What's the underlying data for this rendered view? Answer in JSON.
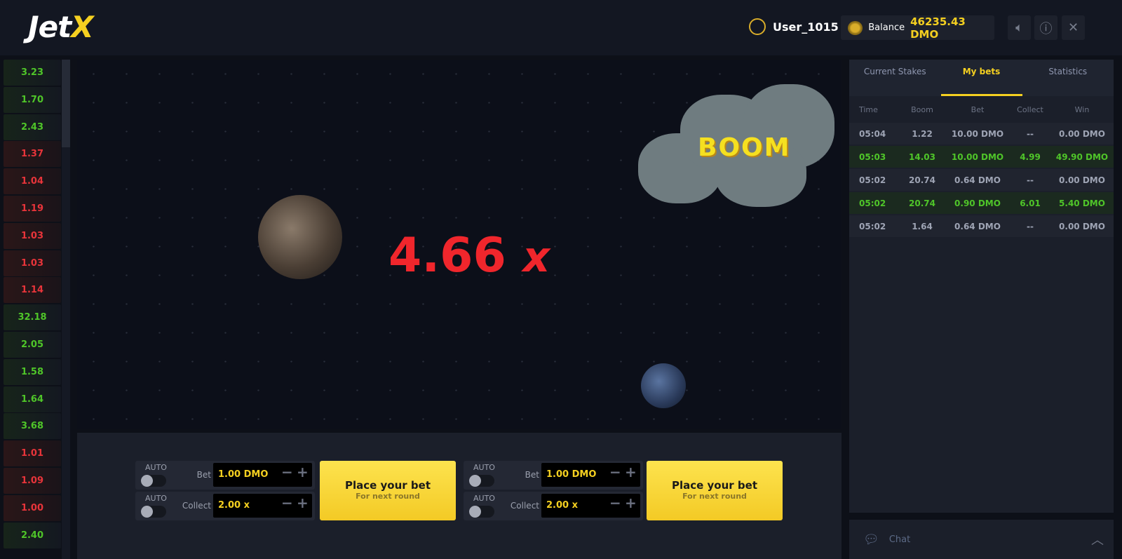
{
  "header": {
    "logo": "JetX",
    "username": "User_1015",
    "balance_label": "Balance",
    "balance_value": "46235.43 DMO",
    "sound_icon": "speaker-icon",
    "info_icon": "info-icon",
    "close_icon": "close-icon"
  },
  "history": [
    {
      "v": "3.23",
      "c": "g"
    },
    {
      "v": "1.70",
      "c": "g"
    },
    {
      "v": "2.43",
      "c": "g"
    },
    {
      "v": "1.37",
      "c": "r"
    },
    {
      "v": "1.04",
      "c": "r"
    },
    {
      "v": "1.19",
      "c": "r"
    },
    {
      "v": "1.03",
      "c": "r"
    },
    {
      "v": "1.03",
      "c": "r"
    },
    {
      "v": "1.14",
      "c": "r"
    },
    {
      "v": "32.18",
      "c": "g"
    },
    {
      "v": "2.05",
      "c": "g"
    },
    {
      "v": "1.58",
      "c": "g"
    },
    {
      "v": "1.64",
      "c": "g"
    },
    {
      "v": "3.68",
      "c": "g"
    },
    {
      "v": "1.01",
      "c": "r"
    },
    {
      "v": "1.09",
      "c": "r"
    },
    {
      "v": "1.00",
      "c": "r"
    },
    {
      "v": "2.40",
      "c": "g"
    }
  ],
  "game": {
    "multiplier": "4.66",
    "multiplier_suffix": "x",
    "boom_text": "BOOM"
  },
  "bet_panels": [
    {
      "auto_label": "AUTO",
      "bet_label": "Bet",
      "bet_value": "1.00 DMO",
      "collect_label": "Collect",
      "collect_value": "2.00 x",
      "button_title": "Place your bet",
      "button_sub": "For next round"
    },
    {
      "auto_label": "AUTO",
      "bet_label": "Bet",
      "bet_value": "1.00 DMO",
      "collect_label": "Collect",
      "collect_value": "2.00 x",
      "button_title": "Place your bet",
      "button_sub": "For next round"
    }
  ],
  "sidebar": {
    "tabs": [
      "Current Stakes",
      "My bets",
      "Statistics"
    ],
    "active_tab": "My bets",
    "columns": [
      "Time",
      "Boom",
      "Bet",
      "Collect",
      "Win"
    ],
    "rows": [
      {
        "cells": [
          "05:04",
          "1.22",
          "10.00 DMO",
          "--",
          "0.00 DMO"
        ],
        "win": false
      },
      {
        "cells": [
          "05:03",
          "14.03",
          "10.00 DMO",
          "4.99",
          "49.90 DMO"
        ],
        "win": true
      },
      {
        "cells": [
          "05:02",
          "20.74",
          "0.64 DMO",
          "--",
          "0.00 DMO"
        ],
        "win": false
      },
      {
        "cells": [
          "05:02",
          "20.74",
          "0.90 DMO",
          "6.01",
          "5.40 DMO"
        ],
        "win": true
      },
      {
        "cells": [
          "05:02",
          "1.64",
          "0.64 DMO",
          "--",
          "0.00 DMO"
        ],
        "win": false
      }
    ]
  },
  "chat": {
    "label": "Chat"
  },
  "colors": {
    "accent": "#f5d020",
    "win": "#4fc529",
    "loss": "#e8343a",
    "multiplier": "#f0262c"
  }
}
